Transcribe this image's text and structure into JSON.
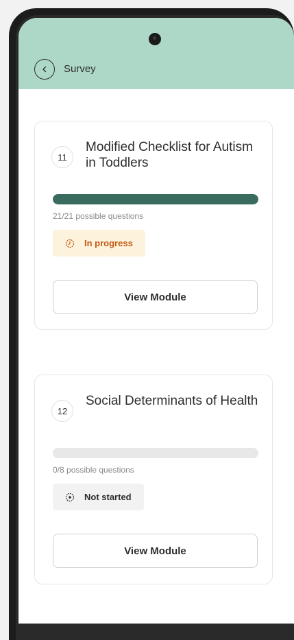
{
  "header": {
    "title": "Survey"
  },
  "modules": [
    {
      "number": "11",
      "title": "Modified Checklist for Autism in Toddlers",
      "progress": 1.0,
      "possible_text": "21/21 possible questions",
      "status": "In progress",
      "status_icon": "clock-icon",
      "button_label": "View Module"
    },
    {
      "number": "12",
      "title": "Social Determinants of Health",
      "progress": 0.0,
      "possible_text": "0/8 possible questions",
      "status": "Not started",
      "status_icon": "dotted-circle-icon",
      "button_label": "View Module"
    }
  ],
  "colors": {
    "header_bg": "#add8c8",
    "progress_fill": "#3a6b5f",
    "in_progress_text": "#c45a16",
    "in_progress_bg": "#fdf3dd"
  }
}
